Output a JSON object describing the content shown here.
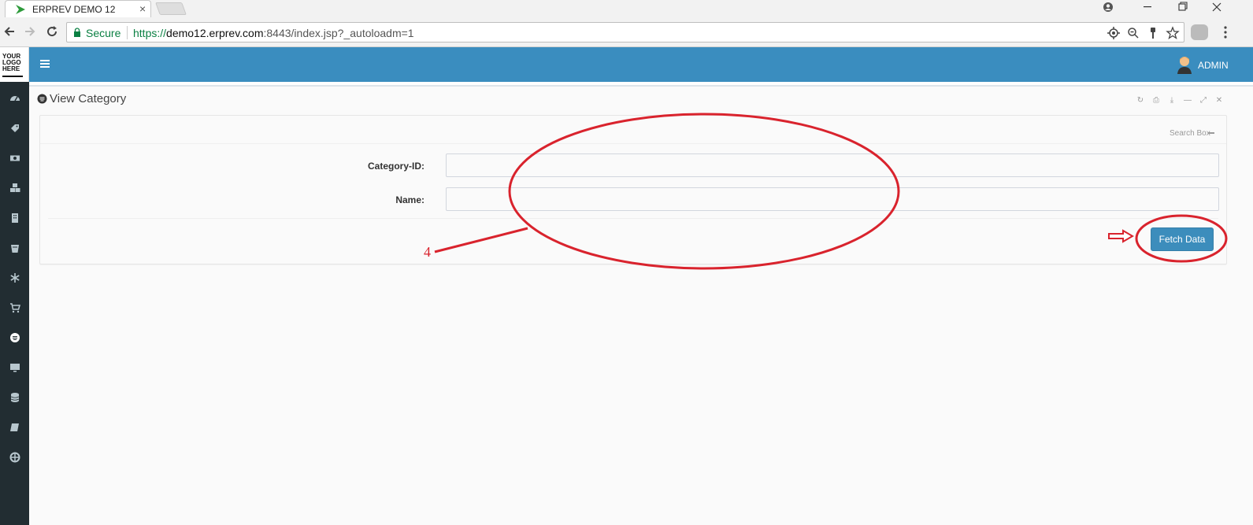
{
  "browser": {
    "tab_title": "ERPREV DEMO 12",
    "tab_close": "×",
    "secure_label": "Secure",
    "url_scheme": "https://",
    "url_host": "demo12.erprev.com",
    "url_rest": ":8443/index.jsp?_autoloadm=1"
  },
  "app": {
    "logo_text": "YOUR\nLOGO\nHERE",
    "user_label": "ADMIN",
    "accent_color": "#3a8dbf",
    "sidebar_color": "#222d32"
  },
  "sidebar": {
    "items": [
      {
        "icon": "dashboard-icon"
      },
      {
        "icon": "tag-icon"
      },
      {
        "icon": "money-icon"
      },
      {
        "icon": "cubes-icon"
      },
      {
        "icon": "building-icon"
      },
      {
        "icon": "bucket-icon"
      },
      {
        "icon": "snowflake-icon"
      },
      {
        "icon": "cart-icon"
      },
      {
        "icon": "category-icon"
      },
      {
        "icon": "monitor-icon"
      },
      {
        "icon": "database-icon"
      },
      {
        "icon": "book-icon"
      },
      {
        "icon": "lifebuoy-icon"
      }
    ]
  },
  "panel": {
    "title": "View Category",
    "search_box_label": "Search Box"
  },
  "form": {
    "category_id_label": "Category-ID:",
    "category_id_value": "",
    "name_label": "Name:",
    "name_value": "",
    "fetch_button_label": "Fetch Data"
  },
  "annotations": {
    "step_number": "4",
    "color": "#d9232d"
  }
}
